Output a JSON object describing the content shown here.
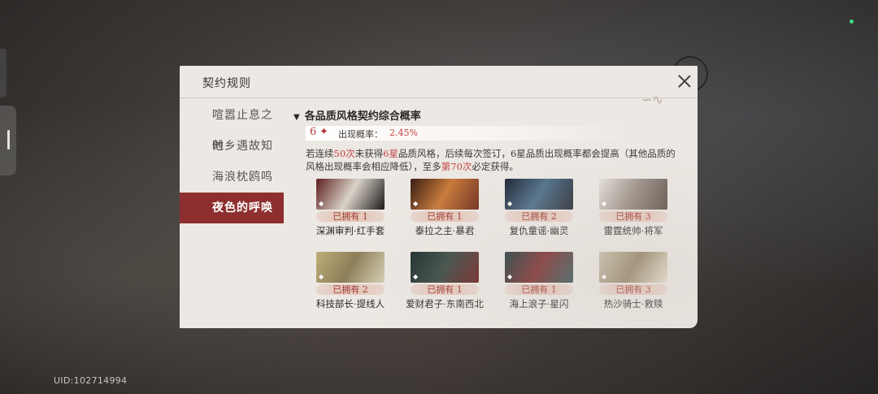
{
  "status": {
    "uid": "UID:102714994"
  },
  "dialog": {
    "title": "契约规则",
    "nav": [
      {
        "label": "喧嚣止息之时",
        "active": false
      },
      {
        "label": "他乡遇故知",
        "active": false
      },
      {
        "label": "海浪枕鸥鸣",
        "active": false
      },
      {
        "label": "夜色的呼唤",
        "active": true
      }
    ],
    "section": {
      "title": "各品质风格契约综合概率",
      "rate_star": "6",
      "rate_label": "出现概率：",
      "rate_value": "2.45%",
      "desc_parts": [
        "若连续",
        "50次",
        "未获得",
        "6星",
        "品质风格，后续每次签订，6星品质出现概率都会提高（其他品质的风格出现概率会相应降低），至多",
        "第70次",
        "必定获得。"
      ]
    },
    "cards": [
      {
        "name": "深渊审判·红手套",
        "owned": "已拥有 1",
        "colors": [
          "#5e1f1f",
          "#d9d2c8",
          "#1e1a1a"
        ]
      },
      {
        "name": "泰拉之主·暴君",
        "owned": "已拥有 1",
        "colors": [
          "#3a1e14",
          "#c97a3a",
          "#6e2b1a"
        ]
      },
      {
        "name": "复仇童谣·幽灵",
        "owned": "已拥有 2",
        "colors": [
          "#1a2433",
          "#4d6f8a",
          "#262a33"
        ]
      },
      {
        "name": "雷霆统帅·将军",
        "owned": "已拥有 3",
        "colors": [
          "#e6e2da",
          "#9a8f86",
          "#5b4f47"
        ]
      },
      {
        "name": "科技部长·提线人",
        "owned": "已拥有 2",
        "colors": [
          "#bfae7a",
          "#8c7e58",
          "#d6cfb4"
        ]
      },
      {
        "name": "爱财君子·东南西北",
        "owned": "已拥有 1",
        "colors": [
          "#1c2a2a",
          "#3b4a43",
          "#6b1f1f"
        ]
      },
      {
        "name": "海上浪子·星闪",
        "owned": "已拥有 1",
        "colors": [
          "#1d3a3a",
          "#7a2a2a",
          "#2c5050"
        ]
      },
      {
        "name": "热沙骑士·救赎",
        "owned": "已拥有 3",
        "colors": [
          "#c7bfa8",
          "#8e7f5e",
          "#e8e0cc"
        ]
      }
    ]
  }
}
